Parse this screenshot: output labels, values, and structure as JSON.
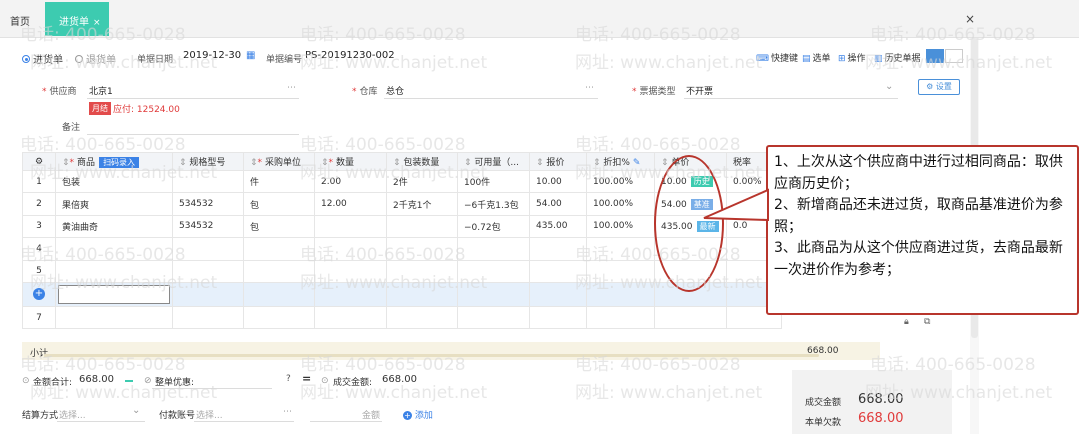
{
  "tabs": {
    "home": "首页",
    "active": "进货单",
    "close_glyph": "×"
  },
  "window": {
    "close_glyph": "×"
  },
  "doc_type": {
    "purchase": "进货单",
    "return": "退货单"
  },
  "header": {
    "date_label": "单据日期",
    "date_value": "2019-12-30",
    "number_label": "单据编号",
    "number_value": "PS-20191230-002",
    "supplier_label": "供应商",
    "supplier_value": "北京1",
    "month_badge": "月结",
    "payable": "应付: 12524.00",
    "warehouse_label": "仓库",
    "warehouse_value": "总仓",
    "invoice_label": "票据类型",
    "invoice_value": "不开票",
    "note_label": "备注",
    "settings_label": "设置"
  },
  "toolbar": {
    "shortcut": "快捷键",
    "select": "选单",
    "operate": "操作",
    "history": "历史单据"
  },
  "table": {
    "columns": [
      "商品",
      "规格型号",
      "采购单位",
      "数量",
      "包装数量",
      "可用量（...",
      "报价",
      "折扣%",
      "单价",
      "税率"
    ],
    "scan_label": "扫码录入",
    "rows": [
      {
        "idx": "1",
        "product": "包装",
        "spec": "",
        "unit": "件",
        "qty": "2.00",
        "pack": "2件",
        "avail": "100件",
        "quote": "10.00",
        "discount": "100.00%",
        "price": "10.00",
        "price_tag": "历史",
        "tax": "0.00%"
      },
      {
        "idx": "2",
        "product": "果倍爽",
        "spec": "534532",
        "unit": "包",
        "qty": "12.00",
        "pack": "2千克1个",
        "avail": "−6千克1.3包",
        "quote": "54.00",
        "discount": "100.00%",
        "price": "54.00",
        "price_tag": "基准",
        "tax": ""
      },
      {
        "idx": "3",
        "product": "黄油曲奇",
        "spec": "534532",
        "unit": "包",
        "qty": "",
        "pack": "",
        "avail": "−0.72包",
        "quote": "435.00",
        "discount": "100.00%",
        "price": "435.00",
        "price_tag": "最新",
        "tax": "0.0"
      },
      {
        "idx": "4"
      },
      {
        "idx": "5"
      },
      {
        "idx": ""
      },
      {
        "idx": "7"
      }
    ],
    "subtotal_label": "小计",
    "subtotal_value": "668.00"
  },
  "footer": {
    "total_label": "金额合计:",
    "total_value": "668.00",
    "discount_label": "整单优惠:",
    "final_label": "成交金额:",
    "final_value": "668.00",
    "settle_label": "结算方式",
    "settle_placeholder": "选择...",
    "account_label": "付款账号",
    "account_placeholder": "选择...",
    "amount_label": "金额",
    "add_label": "添加"
  },
  "summary": {
    "deal_label": "成交金额",
    "deal_value": "668.00",
    "owe_label": "本单欠款",
    "owe_value": "668.00"
  },
  "callout": {
    "line1": "1、上次从这个供应商中进行过相同商品：取供应商历史价；",
    "line2": "2、新增商品还未进过货，取商品基准进价为参照；",
    "line3": "3、此商品为从这个供应商进过货，去商品最新一次进价作为参考；"
  },
  "watermark": {
    "phone": "电话: 400-665-0028",
    "site": "网址: www.chanjet.net"
  },
  "colors": {
    "accent": "#3dcbb0",
    "blue": "#3b82e6",
    "red": "#e03b3b",
    "callout_border": "#b8352c"
  }
}
